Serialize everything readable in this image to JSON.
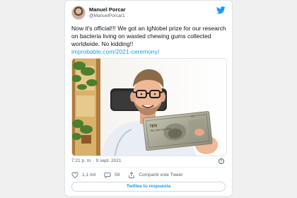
{
  "tweet": {
    "author_name": "Manuel Porcar",
    "author_handle": "@ManuelPorcar1",
    "text": "Now it's official!!! We got an IgNobel prize for our research on bacteria living on wasted chewing gums collected worldwide. No kidding!!",
    "link": "improbable.com/2021-ceremony/",
    "timestamp": "7:21 p. m. · 9 sept. 2021",
    "likes": "1,1 mil",
    "replies": "59",
    "share_label": "Compartir este Tweet",
    "reply_button_label": "Twittea tu respuesta",
    "info_icon": "i"
  },
  "banknote": {
    "top_text": "TEN",
    "sub_text": "TRILLION DOLLARS",
    "serial": "AA"
  },
  "colors": {
    "accent": "#1d9bf0",
    "like": "#536471",
    "text": "#0f1419",
    "muted": "#536471"
  },
  "icons": {
    "brand": "twitter-bird-icon",
    "like": "heart-icon",
    "reply": "reply-icon",
    "share": "share-icon",
    "info": "info-icon"
  }
}
